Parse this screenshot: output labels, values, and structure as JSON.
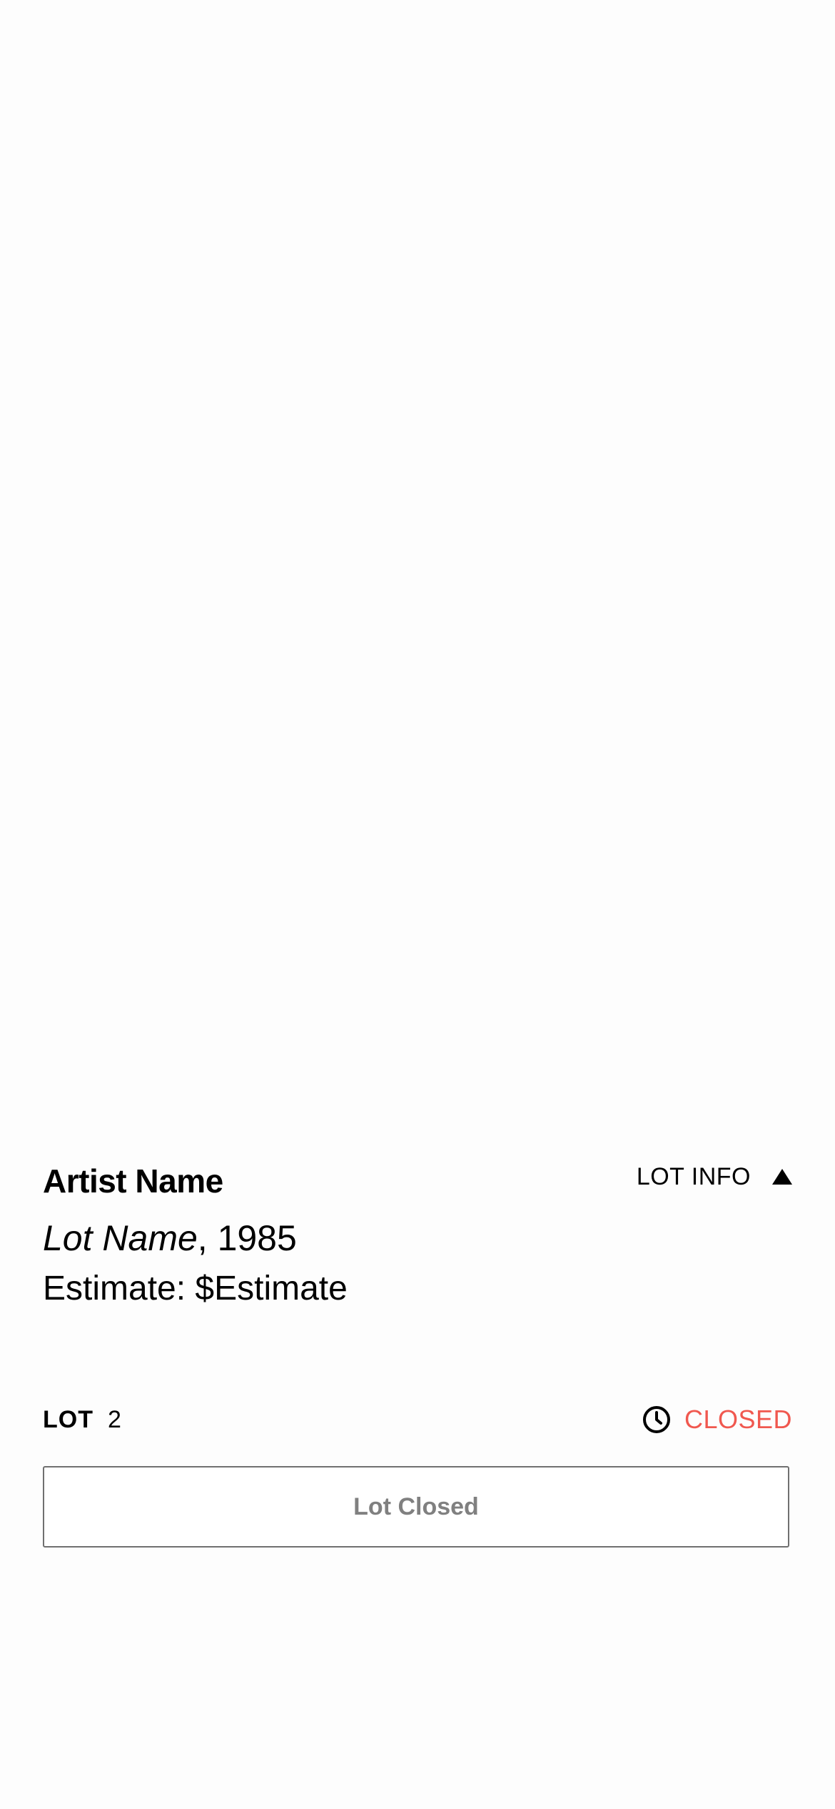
{
  "artwork": {
    "artist_name": "Artist Name",
    "lot_name": "Lot Name",
    "year_suffix": ", 1985",
    "estimate_text": "Estimate: $Estimate"
  },
  "lot_info_toggle": {
    "label": "LOT INFO",
    "icon": "triangle-up-icon"
  },
  "lot": {
    "label": "LOT",
    "number": "2"
  },
  "status": {
    "icon": "clock-icon",
    "text": "CLOSED",
    "color": "#f0584f"
  },
  "bid_button": {
    "label": "Lot Closed",
    "disabled": true
  }
}
